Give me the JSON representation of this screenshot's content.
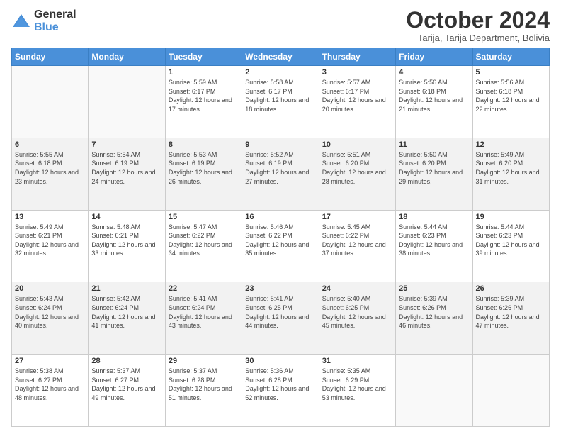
{
  "logo": {
    "general": "General",
    "blue": "Blue"
  },
  "header": {
    "month_year": "October 2024",
    "location": "Tarija, Tarija Department, Bolivia"
  },
  "days_of_week": [
    "Sunday",
    "Monday",
    "Tuesday",
    "Wednesday",
    "Thursday",
    "Friday",
    "Saturday"
  ],
  "weeks": [
    [
      {
        "day": "",
        "info": ""
      },
      {
        "day": "",
        "info": ""
      },
      {
        "day": "1",
        "info": "Sunrise: 5:59 AM\nSunset: 6:17 PM\nDaylight: 12 hours and 17 minutes."
      },
      {
        "day": "2",
        "info": "Sunrise: 5:58 AM\nSunset: 6:17 PM\nDaylight: 12 hours and 18 minutes."
      },
      {
        "day": "3",
        "info": "Sunrise: 5:57 AM\nSunset: 6:17 PM\nDaylight: 12 hours and 20 minutes."
      },
      {
        "day": "4",
        "info": "Sunrise: 5:56 AM\nSunset: 6:18 PM\nDaylight: 12 hours and 21 minutes."
      },
      {
        "day": "5",
        "info": "Sunrise: 5:56 AM\nSunset: 6:18 PM\nDaylight: 12 hours and 22 minutes."
      }
    ],
    [
      {
        "day": "6",
        "info": "Sunrise: 5:55 AM\nSunset: 6:18 PM\nDaylight: 12 hours and 23 minutes."
      },
      {
        "day": "7",
        "info": "Sunrise: 5:54 AM\nSunset: 6:19 PM\nDaylight: 12 hours and 24 minutes."
      },
      {
        "day": "8",
        "info": "Sunrise: 5:53 AM\nSunset: 6:19 PM\nDaylight: 12 hours and 26 minutes."
      },
      {
        "day": "9",
        "info": "Sunrise: 5:52 AM\nSunset: 6:19 PM\nDaylight: 12 hours and 27 minutes."
      },
      {
        "day": "10",
        "info": "Sunrise: 5:51 AM\nSunset: 6:20 PM\nDaylight: 12 hours and 28 minutes."
      },
      {
        "day": "11",
        "info": "Sunrise: 5:50 AM\nSunset: 6:20 PM\nDaylight: 12 hours and 29 minutes."
      },
      {
        "day": "12",
        "info": "Sunrise: 5:49 AM\nSunset: 6:20 PM\nDaylight: 12 hours and 31 minutes."
      }
    ],
    [
      {
        "day": "13",
        "info": "Sunrise: 5:49 AM\nSunset: 6:21 PM\nDaylight: 12 hours and 32 minutes."
      },
      {
        "day": "14",
        "info": "Sunrise: 5:48 AM\nSunset: 6:21 PM\nDaylight: 12 hours and 33 minutes."
      },
      {
        "day": "15",
        "info": "Sunrise: 5:47 AM\nSunset: 6:22 PM\nDaylight: 12 hours and 34 minutes."
      },
      {
        "day": "16",
        "info": "Sunrise: 5:46 AM\nSunset: 6:22 PM\nDaylight: 12 hours and 35 minutes."
      },
      {
        "day": "17",
        "info": "Sunrise: 5:45 AM\nSunset: 6:22 PM\nDaylight: 12 hours and 37 minutes."
      },
      {
        "day": "18",
        "info": "Sunrise: 5:44 AM\nSunset: 6:23 PM\nDaylight: 12 hours and 38 minutes."
      },
      {
        "day": "19",
        "info": "Sunrise: 5:44 AM\nSunset: 6:23 PM\nDaylight: 12 hours and 39 minutes."
      }
    ],
    [
      {
        "day": "20",
        "info": "Sunrise: 5:43 AM\nSunset: 6:24 PM\nDaylight: 12 hours and 40 minutes."
      },
      {
        "day": "21",
        "info": "Sunrise: 5:42 AM\nSunset: 6:24 PM\nDaylight: 12 hours and 41 minutes."
      },
      {
        "day": "22",
        "info": "Sunrise: 5:41 AM\nSunset: 6:24 PM\nDaylight: 12 hours and 43 minutes."
      },
      {
        "day": "23",
        "info": "Sunrise: 5:41 AM\nSunset: 6:25 PM\nDaylight: 12 hours and 44 minutes."
      },
      {
        "day": "24",
        "info": "Sunrise: 5:40 AM\nSunset: 6:25 PM\nDaylight: 12 hours and 45 minutes."
      },
      {
        "day": "25",
        "info": "Sunrise: 5:39 AM\nSunset: 6:26 PM\nDaylight: 12 hours and 46 minutes."
      },
      {
        "day": "26",
        "info": "Sunrise: 5:39 AM\nSunset: 6:26 PM\nDaylight: 12 hours and 47 minutes."
      }
    ],
    [
      {
        "day": "27",
        "info": "Sunrise: 5:38 AM\nSunset: 6:27 PM\nDaylight: 12 hours and 48 minutes."
      },
      {
        "day": "28",
        "info": "Sunrise: 5:37 AM\nSunset: 6:27 PM\nDaylight: 12 hours and 49 minutes."
      },
      {
        "day": "29",
        "info": "Sunrise: 5:37 AM\nSunset: 6:28 PM\nDaylight: 12 hours and 51 minutes."
      },
      {
        "day": "30",
        "info": "Sunrise: 5:36 AM\nSunset: 6:28 PM\nDaylight: 12 hours and 52 minutes."
      },
      {
        "day": "31",
        "info": "Sunrise: 5:35 AM\nSunset: 6:29 PM\nDaylight: 12 hours and 53 minutes."
      },
      {
        "day": "",
        "info": ""
      },
      {
        "day": "",
        "info": ""
      }
    ]
  ]
}
